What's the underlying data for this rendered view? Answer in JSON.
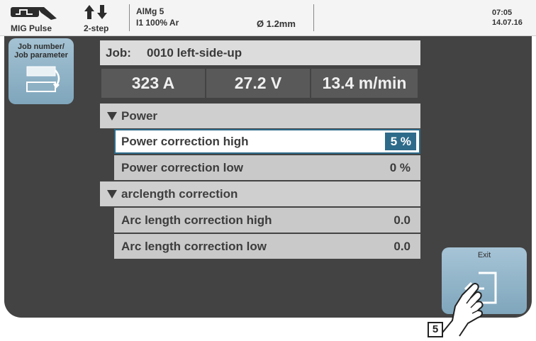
{
  "status": {
    "mode_label": "MIG Pulse",
    "trigger_label": "2-step",
    "material": "AlMg 5",
    "gas": "I1 100% Ar",
    "diameter": "Ø  1.2mm",
    "time": "07:05",
    "date": "14.07.16"
  },
  "side_button": {
    "label_line1": "Job number/",
    "label_line2": "Job parameter"
  },
  "job": {
    "label": "Job:",
    "value": "0010 left-side-up"
  },
  "values": {
    "current": "323 A",
    "voltage": "27.2 V",
    "wire_speed": "13.4 m/min"
  },
  "groups": [
    {
      "title": "Power",
      "rows": [
        {
          "label": "Power correction high",
          "value": "5 %"
        },
        {
          "label": "Power correction low",
          "value": "0 %"
        }
      ]
    },
    {
      "title": "arclength correction",
      "rows": [
        {
          "label": "Arc length correction high",
          "value": "0.0"
        },
        {
          "label": "Arc length correction low",
          "value": "0.0"
        }
      ]
    }
  ],
  "exit_button": {
    "label": "Exit"
  },
  "callout": {
    "number": "5"
  },
  "colors": {
    "panel": "#434343",
    "button_blue": "#8fb3c8",
    "selection": "#2e6b8a"
  }
}
